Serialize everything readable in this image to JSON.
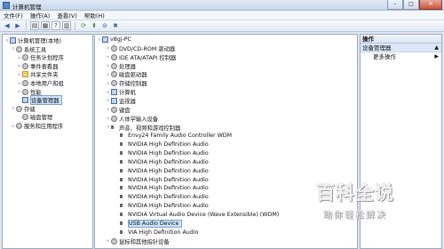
{
  "window": {
    "title": "计算机管理"
  },
  "menu": [
    "文件(F)",
    "操作(A)",
    "查看(V)",
    "帮助(H)"
  ],
  "left_tree": [
    {
      "label": "计算机管理(本地)",
      "level": 0,
      "exp": "▿",
      "icon": "pc"
    },
    {
      "label": "系统工具",
      "level": 1,
      "exp": "▿",
      "icon": "gear"
    },
    {
      "label": "任务计划程序",
      "level": 2,
      "exp": "▹",
      "icon": "gear"
    },
    {
      "label": "事件查看器",
      "level": 2,
      "exp": "▹",
      "icon": "gear"
    },
    {
      "label": "共享文件夹",
      "level": 2,
      "exp": "▹",
      "icon": "folder"
    },
    {
      "label": "本地用户和组",
      "level": 2,
      "exp": "▹",
      "icon": "gear"
    },
    {
      "label": "性能",
      "level": 2,
      "exp": "▹",
      "icon": "gear"
    },
    {
      "label": "设备管理器",
      "level": 2,
      "exp": "",
      "icon": "pc",
      "selected": true
    },
    {
      "label": "存储",
      "level": 1,
      "exp": "▿",
      "icon": "gear"
    },
    {
      "label": "磁盘管理",
      "level": 2,
      "exp": "",
      "icon": "gear"
    },
    {
      "label": "服务和应用程序",
      "level": 1,
      "exp": "▹",
      "icon": "gear"
    }
  ],
  "device_tree": [
    {
      "label": "v8gj-PC",
      "level": 0,
      "exp": "▿",
      "icon": "pc"
    },
    {
      "label": "DVD/CD-ROM 驱动器",
      "level": 1,
      "exp": "▹",
      "icon": "gear"
    },
    {
      "label": "IDE ATA/ATAPI 控制器",
      "level": 1,
      "exp": "▹",
      "icon": "gear"
    },
    {
      "label": "处理器",
      "level": 1,
      "exp": "▹",
      "icon": "gear"
    },
    {
      "label": "磁盘驱动器",
      "level": 1,
      "exp": "▹",
      "icon": "gear"
    },
    {
      "label": "存储控制器",
      "level": 1,
      "exp": "▹",
      "icon": "gear"
    },
    {
      "label": "计算机",
      "level": 1,
      "exp": "▹",
      "icon": "pc"
    },
    {
      "label": "监视器",
      "level": 1,
      "exp": "▹",
      "icon": "pc"
    },
    {
      "label": "键盘",
      "level": 1,
      "exp": "▹",
      "icon": "gear"
    },
    {
      "label": "人体学输入设备",
      "level": 1,
      "exp": "▹",
      "icon": "gear"
    },
    {
      "label": "声音、视频和游戏控制器",
      "level": 1,
      "exp": "▿",
      "icon": "speaker"
    },
    {
      "label": "Envy24 Family Audio Controller WDM",
      "level": 2,
      "exp": "",
      "icon": "speaker"
    },
    {
      "label": "NVIDIA High Definition Audio",
      "level": 2,
      "exp": "",
      "icon": "speaker"
    },
    {
      "label": "NVIDIA High Definition Audio",
      "level": 2,
      "exp": "",
      "icon": "speaker"
    },
    {
      "label": "NVIDIA High Definition Audio",
      "level": 2,
      "exp": "",
      "icon": "speaker"
    },
    {
      "label": "NVIDIA High Definition Audio",
      "level": 2,
      "exp": "",
      "icon": "speaker"
    },
    {
      "label": "NVIDIA High Definition Audio",
      "level": 2,
      "exp": "",
      "icon": "speaker"
    },
    {
      "label": "NVIDIA High Definition Audio",
      "level": 2,
      "exp": "",
      "icon": "speaker"
    },
    {
      "label": "NVIDIA High Definition Audio",
      "level": 2,
      "exp": "",
      "icon": "speaker"
    },
    {
      "label": "NVIDIA High Definition Audio",
      "level": 2,
      "exp": "",
      "icon": "speaker"
    },
    {
      "label": "NVIDIA Virtual Audio Device (Wave Extensible) (WDM)",
      "level": 2,
      "exp": "",
      "icon": "speaker"
    },
    {
      "label": "USB Audio Device",
      "level": 2,
      "exp": "",
      "icon": "speaker",
      "selected": true
    },
    {
      "label": "VIA High Definition Audio",
      "level": 2,
      "exp": "",
      "icon": "speaker"
    },
    {
      "label": "鼠标和其他指针设备",
      "level": 1,
      "exp": "▹",
      "icon": "gear"
    }
  ],
  "actions": {
    "header": "操作",
    "section": "设备管理器",
    "more": "更多操作"
  },
  "watermark": {
    "title": "百科全说",
    "subtitle": "助你轻松解决"
  }
}
